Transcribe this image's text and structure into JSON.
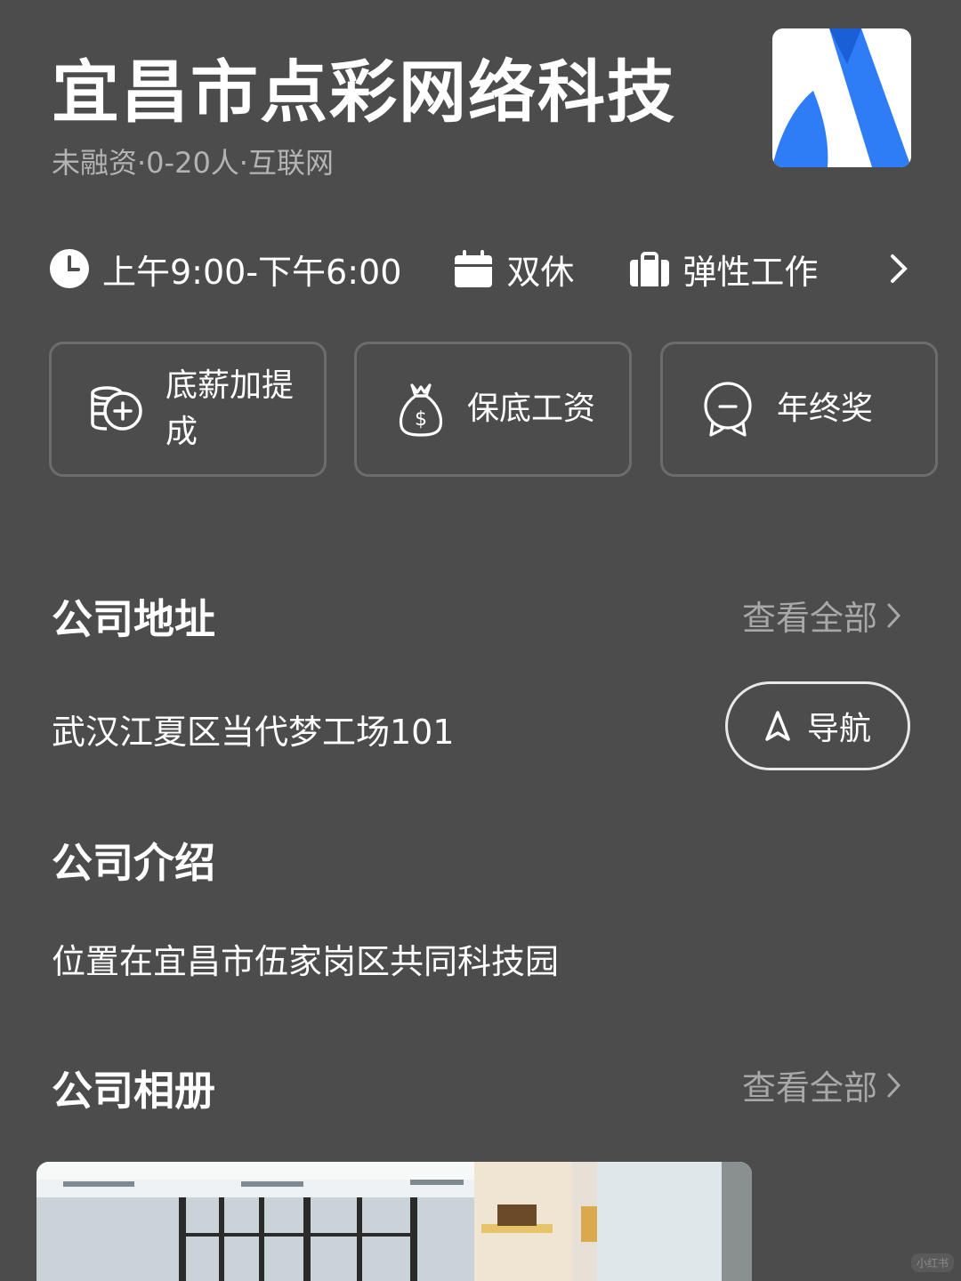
{
  "company": {
    "name": "宜昌市点彩网络科技",
    "meta": "未融资·0-20人·互联网"
  },
  "info_row": {
    "hours": "上午9:00-下午6:00",
    "rest": "双休",
    "work_style": "弹性工作"
  },
  "benefits": [
    {
      "label": "底薪加提成",
      "icon": "coins-plus-icon"
    },
    {
      "label": "保底工资",
      "icon": "money-bag-icon"
    },
    {
      "label": "年终奖",
      "icon": "medal-icon"
    }
  ],
  "address": {
    "title": "公司地址",
    "view_all": "查看全部",
    "text": "武汉江夏区当代梦工场101",
    "nav_label": "导航"
  },
  "intro": {
    "title": "公司介绍",
    "text": "位置在宜昌市伍家岗区共同科技园"
  },
  "album": {
    "title": "公司相册",
    "view_all": "查看全部"
  },
  "watermark": "小红书",
  "colors": {
    "background": "#4c4c4c",
    "logo_blue": "#2e7cf6",
    "muted_text": "#a8a8a8"
  }
}
